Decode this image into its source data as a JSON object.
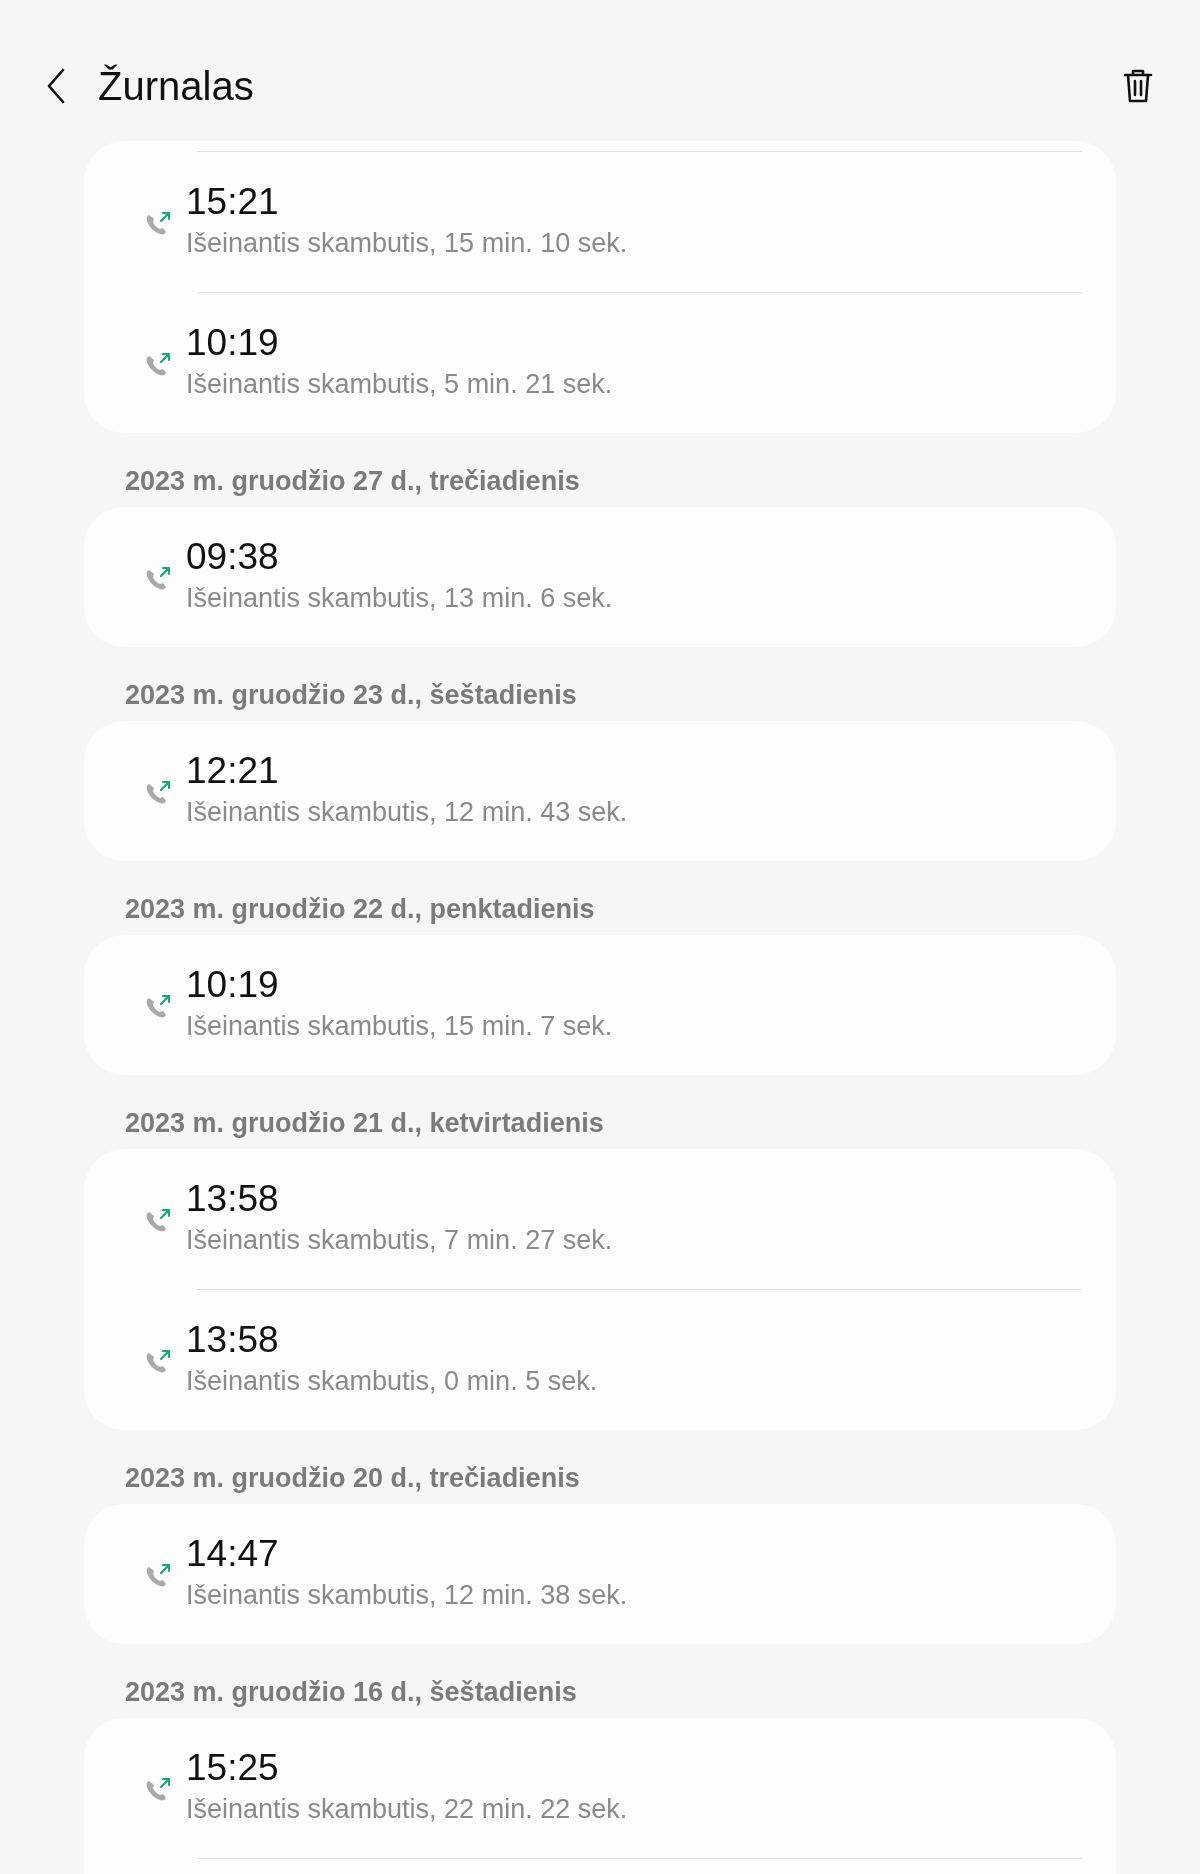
{
  "header": {
    "title": "Žurnalas"
  },
  "sections": [
    {
      "calls": [
        {
          "kind": "outgoing",
          "time": "15:21",
          "detail": "Išeinantis skambutis, 15 min. 10 sek."
        },
        {
          "kind": "outgoing",
          "time": "10:19",
          "detail": "Išeinantis skambutis, 5 min. 21 sek."
        }
      ]
    },
    {
      "date": "2023 m. gruodžio 27 d., trečiadienis",
      "calls": [
        {
          "kind": "outgoing",
          "time": "09:38",
          "detail": "Išeinantis skambutis, 13 min. 6 sek."
        }
      ]
    },
    {
      "date": "2023 m. gruodžio 23 d., šeštadienis",
      "calls": [
        {
          "kind": "outgoing",
          "time": "12:21",
          "detail": "Išeinantis skambutis, 12 min. 43 sek."
        }
      ]
    },
    {
      "date": "2023 m. gruodžio 22 d., penktadienis",
      "calls": [
        {
          "kind": "outgoing",
          "time": "10:19",
          "detail": "Išeinantis skambutis, 15 min. 7 sek."
        }
      ]
    },
    {
      "date": "2023 m. gruodžio 21 d., ketvirtadienis",
      "calls": [
        {
          "kind": "outgoing",
          "time": "13:58",
          "detail": "Išeinantis skambutis, 7 min. 27 sek."
        },
        {
          "kind": "outgoing",
          "time": "13:58",
          "detail": "Išeinantis skambutis, 0 min. 5 sek."
        }
      ]
    },
    {
      "date": "2023 m. gruodžio 20 d., trečiadienis",
      "calls": [
        {
          "kind": "outgoing",
          "time": "14:47",
          "detail": "Išeinantis skambutis, 12 min. 38 sek."
        }
      ]
    },
    {
      "date": "2023 m. gruodžio 16 d., šeštadienis",
      "calls": [
        {
          "kind": "outgoing",
          "time": "15:25",
          "detail": "Išeinantis skambutis, 22 min. 22 sek."
        }
      ]
    }
  ]
}
